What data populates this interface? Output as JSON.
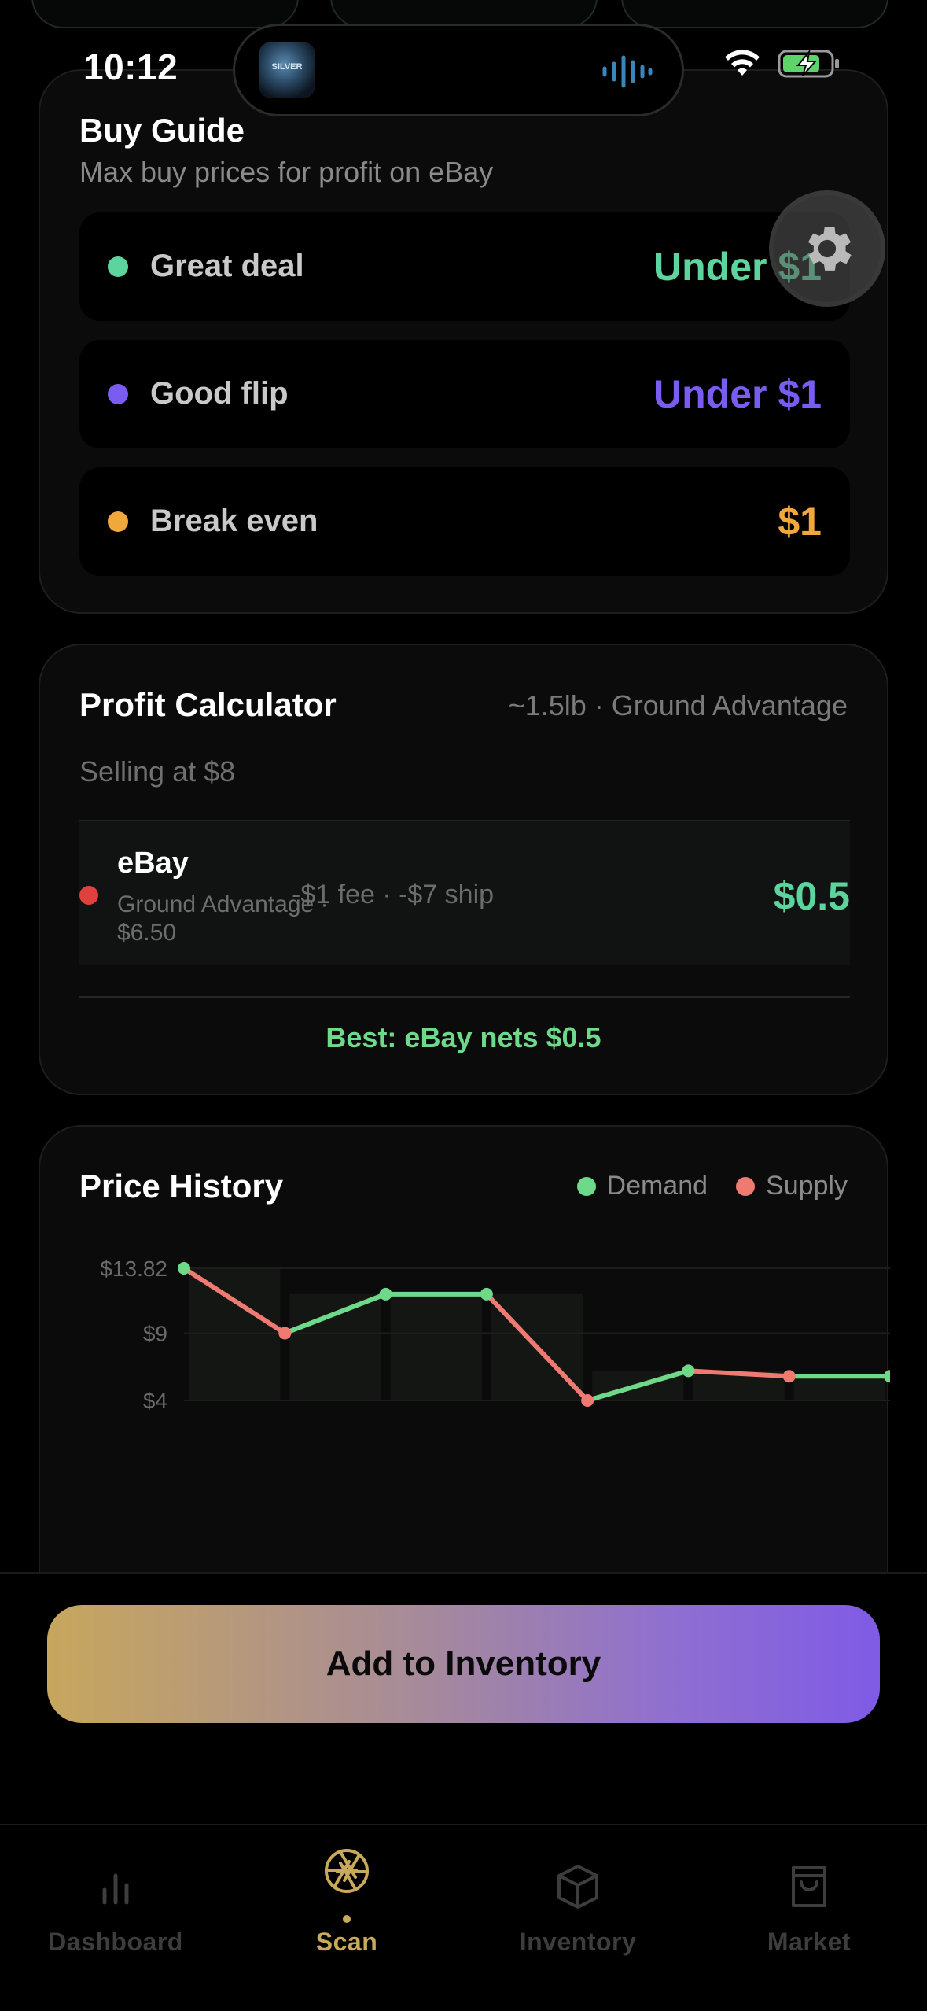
{
  "status_bar": {
    "time": "10:12",
    "island_app_label": "SILVER"
  },
  "buy_guide": {
    "title": "Buy Guide",
    "subtitle": "Max buy prices for profit on eBay",
    "tiers": [
      {
        "label": "Great deal",
        "price": "Under $1",
        "color": "#5dd39e"
      },
      {
        "label": "Good flip",
        "price": "Under $1",
        "color": "#7b5cf0"
      },
      {
        "label": "Break even",
        "price": "$1",
        "color": "#f0a73b"
      }
    ]
  },
  "profit_calculator": {
    "title": "Profit Calculator",
    "meta": "~1.5lb · Ground Advantage",
    "selling": "Selling at $8",
    "rows": [
      {
        "platform": "eBay",
        "shipping": "Ground Advantage · $6.50",
        "fees": "-$1 fee · -$7 ship",
        "net": "$0.5"
      }
    ],
    "best": "Best: eBay nets $0.5"
  },
  "price_history": {
    "title": "Price History",
    "legend": [
      {
        "name": "Demand",
        "color": "#6fd98a"
      },
      {
        "name": "Supply",
        "color": "#ee7a72"
      }
    ],
    "y_ticks": [
      "$13.82",
      "$9",
      "$4"
    ]
  },
  "chart_data": {
    "type": "line",
    "title": "Price History",
    "ylim": [
      4,
      13.82
    ],
    "y_tick_labels": [
      "$13.82",
      "$9",
      "$4"
    ],
    "x": [
      0,
      1,
      2,
      3,
      4,
      5,
      6,
      7
    ],
    "values": [
      13.82,
      9,
      11.9,
      11.9,
      4,
      6.2,
      5.8,
      5.8
    ],
    "segment_colors": [
      "#ee7a72",
      "#6fd98a",
      "#6fd98a",
      "#ee7a72",
      "#6fd98a",
      "#ee7a72",
      "#6fd98a"
    ],
    "point_colors": [
      "#6fd98a",
      "#ee7a72",
      "#6fd98a",
      "#6fd98a",
      "#ee7a72",
      "#6fd98a",
      "#ee7a72",
      "#6fd98a"
    ],
    "grid": true
  },
  "cta": {
    "label": "Add to Inventory"
  },
  "tabs": [
    {
      "label": "Dashboard",
      "active": false
    },
    {
      "label": "Scan",
      "active": true
    },
    {
      "label": "Inventory",
      "active": false
    },
    {
      "label": "Market",
      "active": false
    }
  ]
}
